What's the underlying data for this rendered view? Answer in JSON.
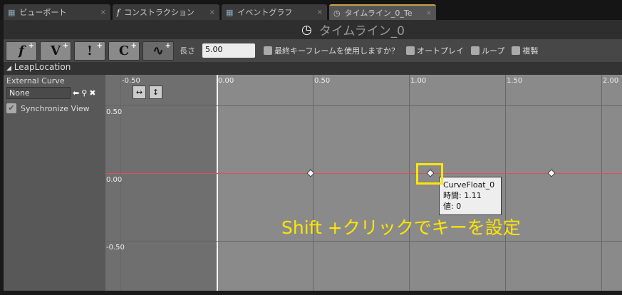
{
  "tabs": [
    {
      "label": "ビューポート",
      "icon": "viewport-icon"
    },
    {
      "label": "コンストラクション",
      "icon": "function-icon"
    },
    {
      "label": "イベントグラフ",
      "icon": "graph-icon"
    },
    {
      "label": "タイムライン_0_Te",
      "icon": "clock-icon",
      "active": true
    }
  ],
  "title": "タイムライン_0",
  "toolbar": {
    "buttons": [
      "f",
      "V",
      "!",
      "C",
      ""
    ],
    "length_label": "長さ",
    "length_value": "5.00",
    "options": [
      "最終キーフレームを使用しますか？",
      "オートプレイ",
      "ループ",
      "複製"
    ]
  },
  "track": {
    "name": "LeapLocation"
  },
  "side": {
    "external_curve_label": "External Curve",
    "curve_value": "None",
    "sync_label": "Synchronize View",
    "sync_checked": true
  },
  "graph": {
    "time_labels": [
      "-0.50",
      "0.00",
      "0.50",
      "1.00",
      "1.50",
      "2.00"
    ],
    "value_labels": [
      "0.50",
      "0.00",
      "-0.50"
    ],
    "keys": [
      {
        "time": 0.49,
        "value": 0
      },
      {
        "time": 1.11,
        "value": 0
      },
      {
        "time": 1.74,
        "value": 0
      }
    ],
    "curve_color": "#e05050"
  },
  "tooltip": {
    "name": "CurveFloat_0",
    "time": "時間: 1.11",
    "value": "値: 0"
  },
  "hint": "Shift +クリックでキーを設定"
}
